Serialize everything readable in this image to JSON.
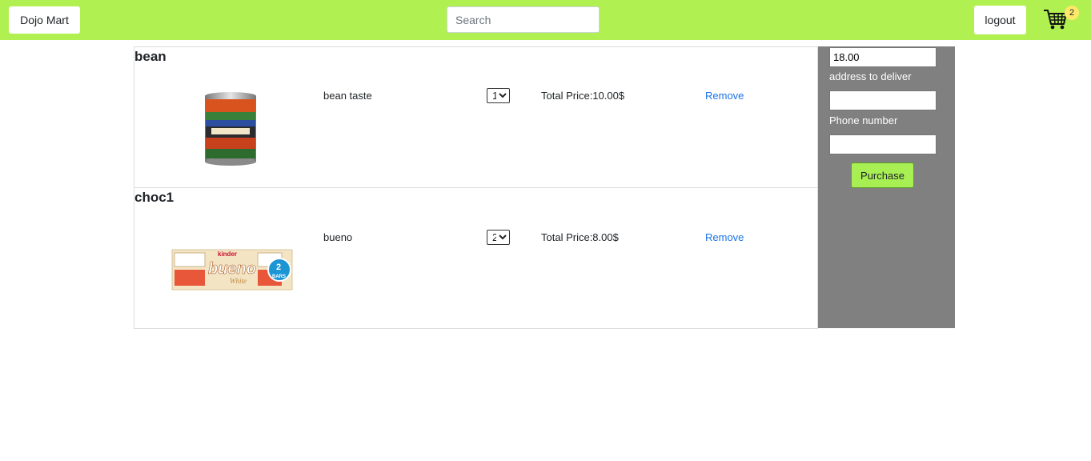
{
  "header": {
    "brand_label": "Dojo Mart",
    "search_placeholder": "Search",
    "logout_label": "logout",
    "cart_icon": "cart-icon",
    "cart_count": "2",
    "accent_color": "#b0f050"
  },
  "cart_items": [
    {
      "title": "bean",
      "description": "bean taste",
      "quantity": "1",
      "total": "Total Price:10.00$",
      "remove_label": "Remove",
      "image": "canned-beans-image"
    },
    {
      "title": "choc1",
      "description": "bueno",
      "quantity": "2",
      "total": "Total Price:8.00$",
      "remove_label": "Remove",
      "image": "chocolate-bar-image",
      "image_text": [
        "kinder",
        "bueno",
        "White",
        "2",
        "BARS"
      ]
    }
  ],
  "checkout": {
    "total_value": "18.00",
    "address_label": "address to deliver",
    "address_value": "",
    "phone_label": "Phone number",
    "phone_value": "",
    "purchase_label": "Purchase",
    "panel_color": "#808080"
  }
}
